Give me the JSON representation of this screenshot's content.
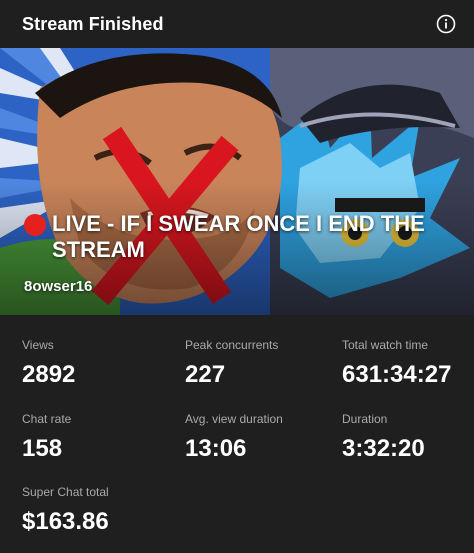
{
  "header": {
    "title": "Stream Finished",
    "info_icon": "info-icon"
  },
  "stream": {
    "title": "LIVE - IF I SWEAR ONCE I END THE STREAM",
    "live_indicator": "red-circle",
    "channel": "8owser16"
  },
  "stats": [
    {
      "label": "Views",
      "value": "2892"
    },
    {
      "label": "Peak concurrents",
      "value": "227"
    },
    {
      "label": "Total watch time",
      "value": "631:34:27"
    },
    {
      "label": "Chat rate",
      "value": "158"
    },
    {
      "label": "Avg. view duration",
      "value": "13:06"
    },
    {
      "label": "Duration",
      "value": "3:32:20"
    },
    {
      "label": "Super Chat total",
      "value": "$163.86"
    }
  ],
  "colors": {
    "background": "#1f1f1f",
    "label": "#aaaaaa",
    "live_dot": "#e5211d",
    "cross": "#d9161f"
  }
}
